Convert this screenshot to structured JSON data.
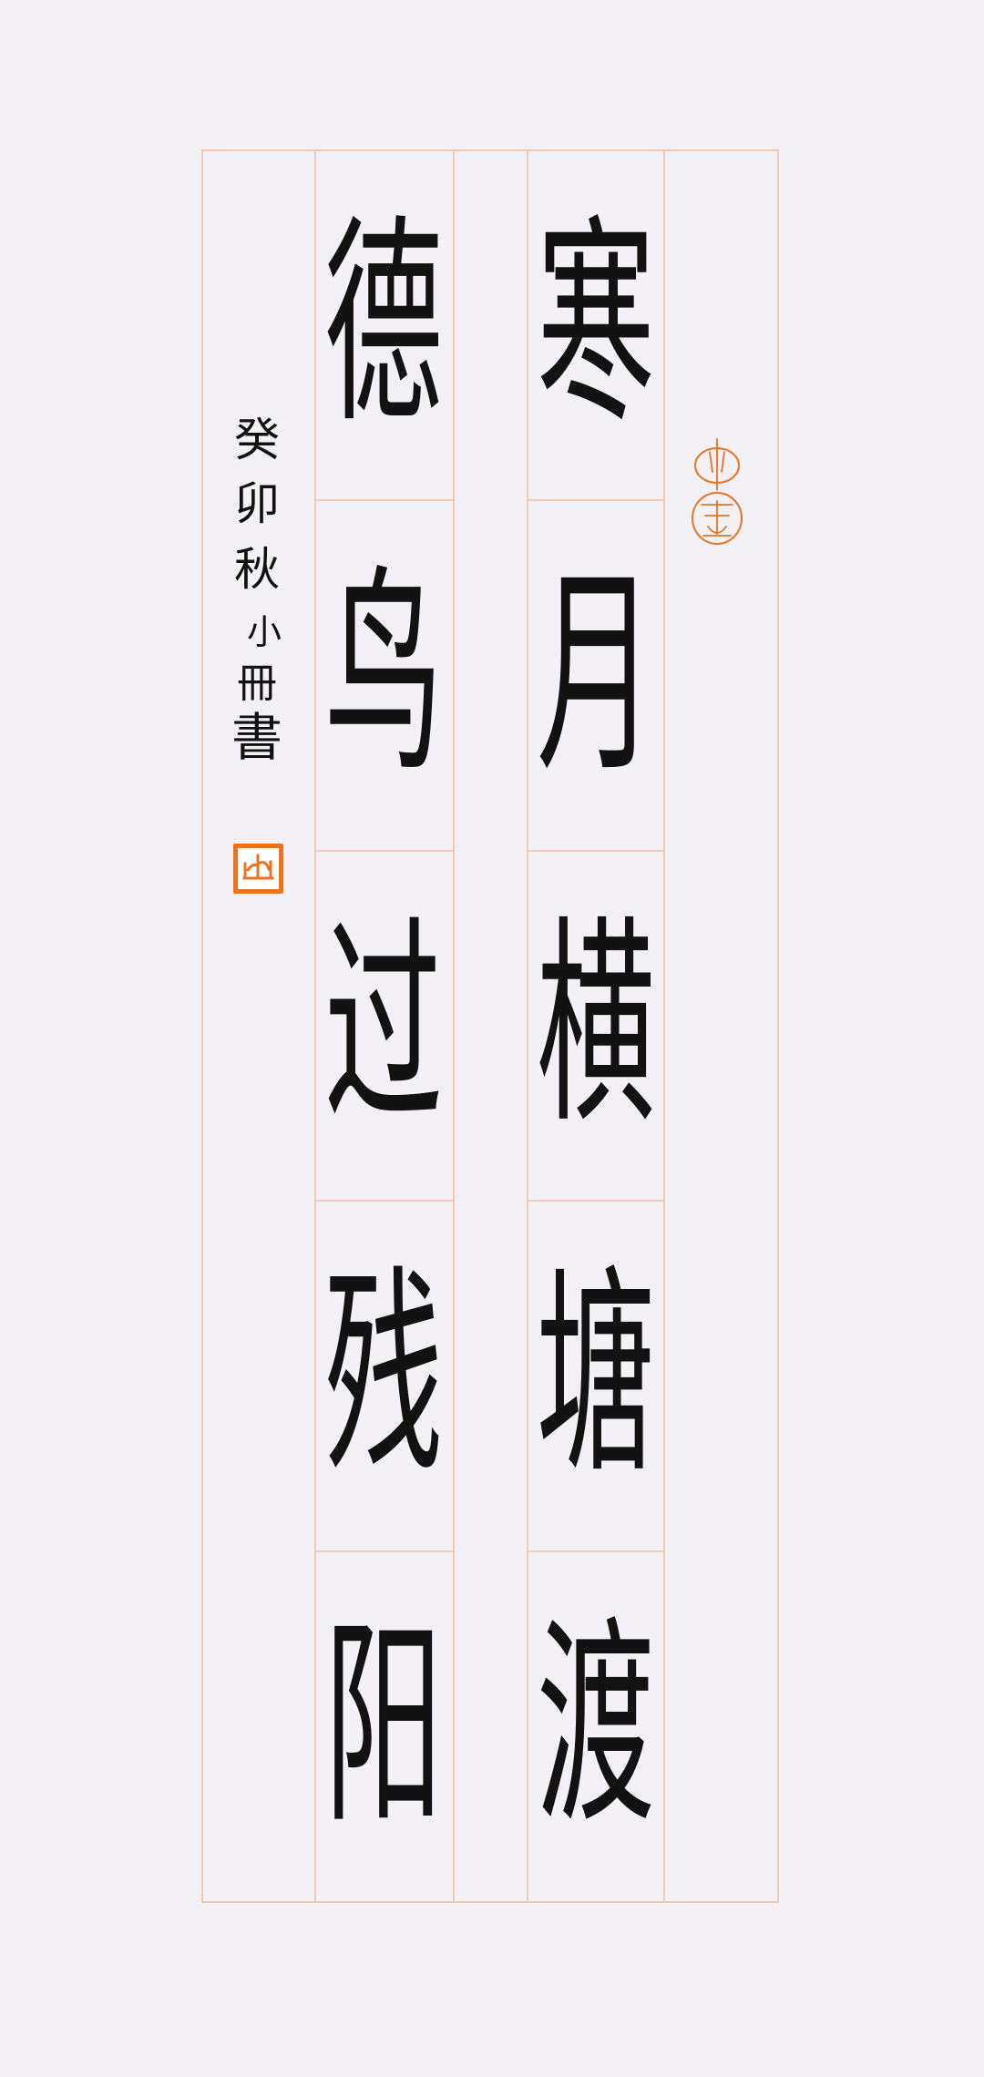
{
  "artwork": {
    "poem_right_column": [
      "寒",
      "月",
      "横",
      "塘",
      "渡"
    ],
    "poem_left_column": [
      "德",
      "鸟",
      "过",
      "残",
      "阳"
    ],
    "signature": {
      "chars": [
        "癸",
        "卯",
        "秋",
        "小",
        "冊",
        "書"
      ]
    },
    "seal_top_text": "小舟",
    "seal_name_text": "山"
  },
  "colors": {
    "background": "#f3f1f6",
    "grid": "#efc3a6",
    "ink": "#121212",
    "seal": "#e8741f"
  }
}
